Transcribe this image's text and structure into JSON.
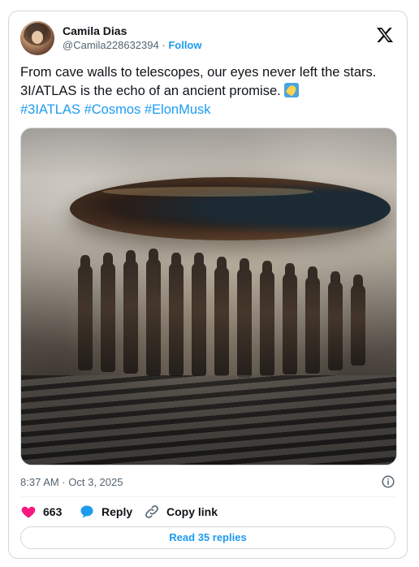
{
  "author": {
    "name": "Camila Dias",
    "handle": "@Camila228632394",
    "separator": "·",
    "follow_label": "Follow"
  },
  "tweet": {
    "text": "From cave walls to telescopes, our eyes never left the stars. 3I/ATLAS is the echo of an ancient promise.",
    "emoji_icon": "comet-icon",
    "hashtags": [
      "#3IATLAS",
      "#Cosmos",
      "#ElonMusk"
    ],
    "timestamp": "8:37 AM · Oct 3, 2025"
  },
  "actions": {
    "likes": "663",
    "reply_label": "Reply",
    "copy_link_label": "Copy link"
  },
  "read_replies_label": "Read 35 replies",
  "colors": {
    "accent": "#1d9bf0",
    "like": "#f91880",
    "secondary_text": "#536471",
    "border": "#cfd9de"
  }
}
